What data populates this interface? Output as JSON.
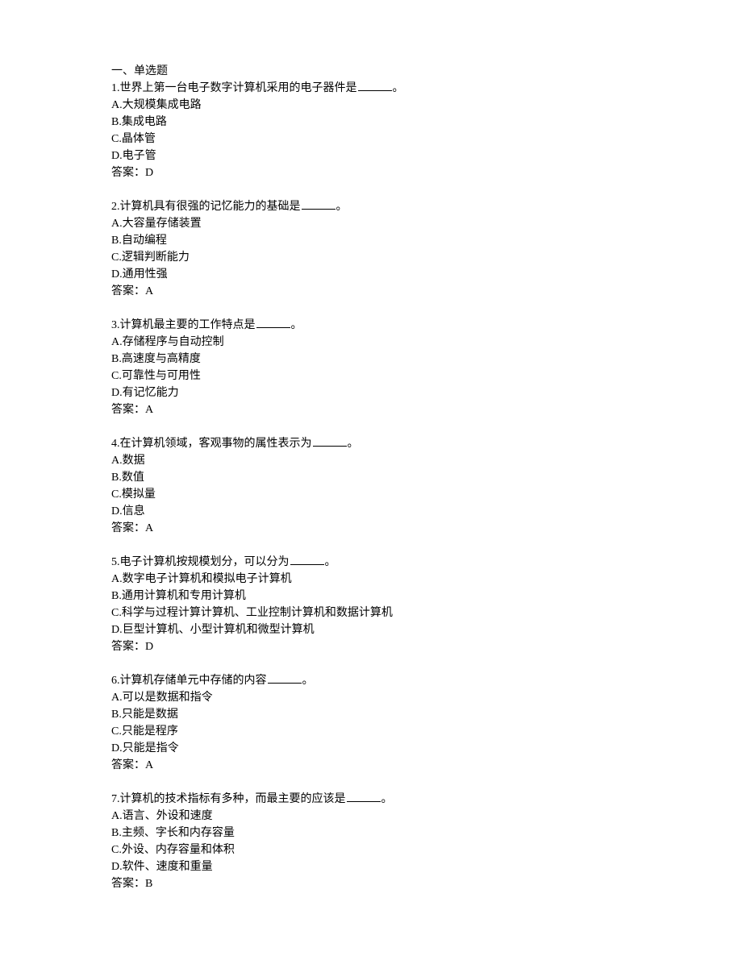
{
  "section_title": "一、单选题",
  "answer_label_prefix": "答案：",
  "questions": [
    {
      "number": "1.",
      "stem_before": "世界上第一台电子数字计算机采用的电子器件是",
      "stem_after": "。",
      "options": [
        "A.大规模集成电路",
        "B.集成电路",
        "C.晶体管",
        "D.电子管"
      ],
      "answer": "D"
    },
    {
      "number": "2.",
      "stem_before": "计算机具有很强的记忆能力的基础是",
      "stem_after": "。",
      "options": [
        "A.大容量存储装置",
        "B.自动编程",
        "C.逻辑判断能力",
        "D.通用性强"
      ],
      "answer": "A"
    },
    {
      "number": "3.",
      "stem_before": "计算机最主要的工作特点是",
      "stem_after": "。",
      "options": [
        "A.存储程序与自动控制",
        "B.高速度与高精度",
        "C.可靠性与可用性",
        "D.有记忆能力"
      ],
      "answer": "A"
    },
    {
      "number": "4.",
      "stem_before": "在计算机领域，客观事物的属性表示为",
      "stem_after": "。",
      "options": [
        "A.数据",
        "B.数值",
        "C.模拟量",
        "D.信息"
      ],
      "answer": "A"
    },
    {
      "number": "5.",
      "stem_before": "电子计算机按规模划分，可以分为",
      "stem_after": "。",
      "options": [
        "A.数字电子计算机和模拟电子计算机",
        "B.通用计算机和专用计算机",
        "C.科学与过程计算计算机、工业控制计算机和数据计算机",
        "D.巨型计算机、小型计算机和微型计算机"
      ],
      "answer": "D"
    },
    {
      "number": "6.",
      "stem_before": "计算机存储单元中存储的内容",
      "stem_after": "。",
      "options": [
        "A.可以是数据和指令",
        "B.只能是数据",
        "C.只能是程序",
        "D.只能是指令"
      ],
      "answer": "A"
    },
    {
      "number": "7.",
      "stem_before": "计算机的技术指标有多种，而最主要的应该是",
      "stem_after": "。",
      "options": [
        "A.语言、外设和速度",
        "B.主频、字长和内存容量",
        "C.外设、内存容量和体积",
        "D.软件、速度和重量"
      ],
      "answer": "B"
    }
  ]
}
